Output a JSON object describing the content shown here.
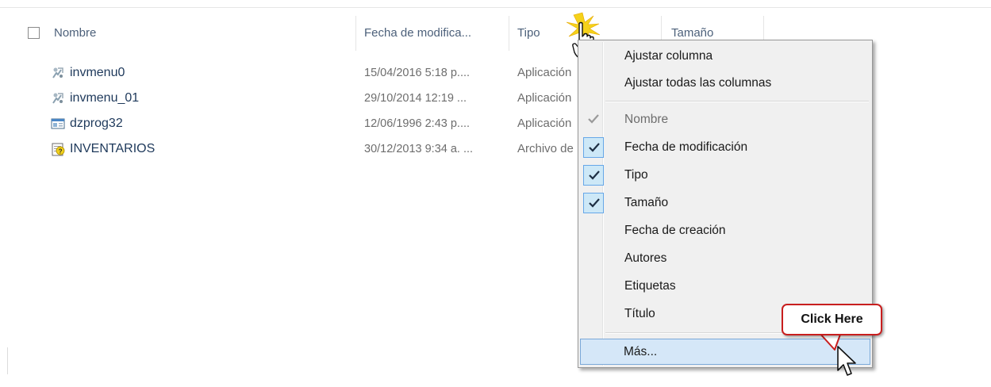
{
  "columns": {
    "name": "Nombre",
    "date": "Fecha de modifica...",
    "type": "Tipo",
    "size": "Tamaño"
  },
  "files": [
    {
      "name": "invmenu0",
      "date": "15/04/2016 5:18 p....",
      "type": "Aplicación",
      "icon": "application-icon"
    },
    {
      "name": "invmenu_01",
      "date": "29/10/2014 12:19 ...",
      "type": "Aplicación",
      "icon": "application-icon"
    },
    {
      "name": "dzprog32",
      "date": "12/06/1996 2:43 p....",
      "type": "Aplicación",
      "icon": "window-app-icon"
    },
    {
      "name": "INVENTARIOS",
      "date": "30/12/2013 9:34 a. ...",
      "type": "Archivo de",
      "icon": "help-file-icon"
    }
  ],
  "context_menu": {
    "fit_column": "Ajustar columna",
    "fit_all_columns": "Ajustar todas las columnas",
    "columns": [
      {
        "label": "Nombre",
        "checked": true,
        "disabled": true
      },
      {
        "label": "Fecha de modificación",
        "checked": true,
        "disabled": false
      },
      {
        "label": "Tipo",
        "checked": true,
        "disabled": false
      },
      {
        "label": "Tamaño",
        "checked": true,
        "disabled": false
      },
      {
        "label": "Fecha de creación",
        "checked": false,
        "disabled": false
      },
      {
        "label": "Autores",
        "checked": false,
        "disabled": false
      },
      {
        "label": "Etiquetas",
        "checked": false,
        "disabled": false
      },
      {
        "label": "Título",
        "checked": false,
        "disabled": false
      }
    ],
    "more": "Más..."
  },
  "callout": {
    "text": "Click Here",
    "color": "#c81e1e"
  },
  "colors": {
    "accent": "#66a7e8",
    "hover": "#d5e7f8",
    "text": "#1e395b"
  }
}
